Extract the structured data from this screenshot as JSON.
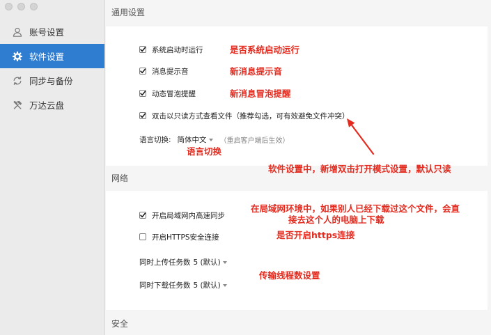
{
  "colors": {
    "accent": "#2f7dd1",
    "sidebar": "#ebebeb",
    "section": "#f5f5f5",
    "card": "#ffffff",
    "annotation": "#e32b1f",
    "window_control": "#d4d4d4"
  },
  "sidebar": {
    "items": [
      {
        "label": "账号设置",
        "icon": "person-icon",
        "selected": false
      },
      {
        "label": "软件设置",
        "icon": "gear-icon",
        "selected": true
      },
      {
        "label": "同步与备份",
        "icon": "sync-icon",
        "selected": false
      },
      {
        "label": "万达云盘",
        "icon": "tools-icon",
        "selected": false
      }
    ]
  },
  "general": {
    "title": "通用设置",
    "options": [
      {
        "label": "系统启动时运行",
        "checked": true
      },
      {
        "label": "消息提示音",
        "checked": true
      },
      {
        "label": "动态冒泡提醒",
        "checked": true
      },
      {
        "label": "双击以只读方式查看文件（推荐勾选，可有效避免文件冲突）",
        "checked": true
      }
    ],
    "language": {
      "label": "语言切换:",
      "value": "简体中文",
      "note": "（重启客户端后生效）"
    }
  },
  "network": {
    "title": "网络",
    "options": [
      {
        "label": "开启局域网内高速同步",
        "checked": true
      },
      {
        "label": "开启HTTPS安全连接",
        "checked": false
      }
    ],
    "upload": {
      "label": "同时上传任务数",
      "value": "5 (默认)"
    },
    "download": {
      "label": "同时下载任务数",
      "value": "5 (默认)"
    }
  },
  "security": {
    "title": "安全"
  },
  "annotations": {
    "startup": "是否系统启动运行",
    "sound": "新消息提示音",
    "bubble": "新消息冒泡提醒",
    "language": "语言切换",
    "readonly_feature": "软件设置中，新增双击打开模式设置，默认只读",
    "lan_line1": "在局域网环境中，如果别人已经下载过这个文件，会直",
    "lan_line2": "接去这个人的电脑上下载",
    "https": "是否开启https连接",
    "threads": "传输线程数设置"
  }
}
